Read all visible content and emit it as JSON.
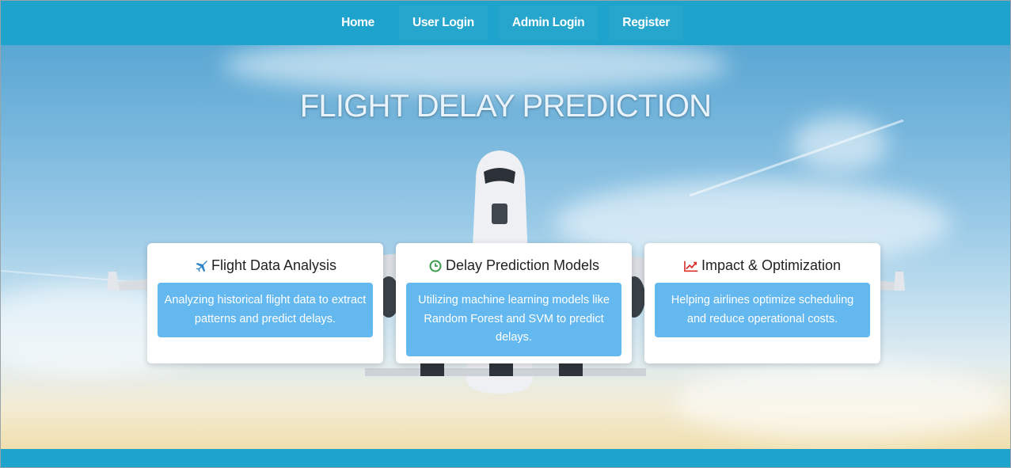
{
  "nav": {
    "items": [
      {
        "label": "Home"
      },
      {
        "label": "User Login"
      },
      {
        "label": "Admin Login"
      },
      {
        "label": "Register"
      }
    ]
  },
  "hero": {
    "title": "FLIGHT DELAY PREDICTION"
  },
  "cards": [
    {
      "icon": "airplane-icon",
      "title": "Flight Data Analysis",
      "text": "Analyzing historical flight data to extract patterns and predict delays.",
      "icon_color": "#2e86c9"
    },
    {
      "icon": "clock-icon",
      "title": "Delay Prediction Models",
      "text": "Utilizing machine learning models like Random Forest and SVM to predict delays.",
      "icon_color": "#3a9b4a"
    },
    {
      "icon": "trend-chart-icon",
      "title": "Impact & Optimization",
      "text": "Helping airlines optimize scheduling and reduce operational costs.",
      "icon_color": "#d9322e"
    }
  ],
  "colors": {
    "nav_bg": "#1ea3cc",
    "card_body_bg": "#64b8f0"
  }
}
